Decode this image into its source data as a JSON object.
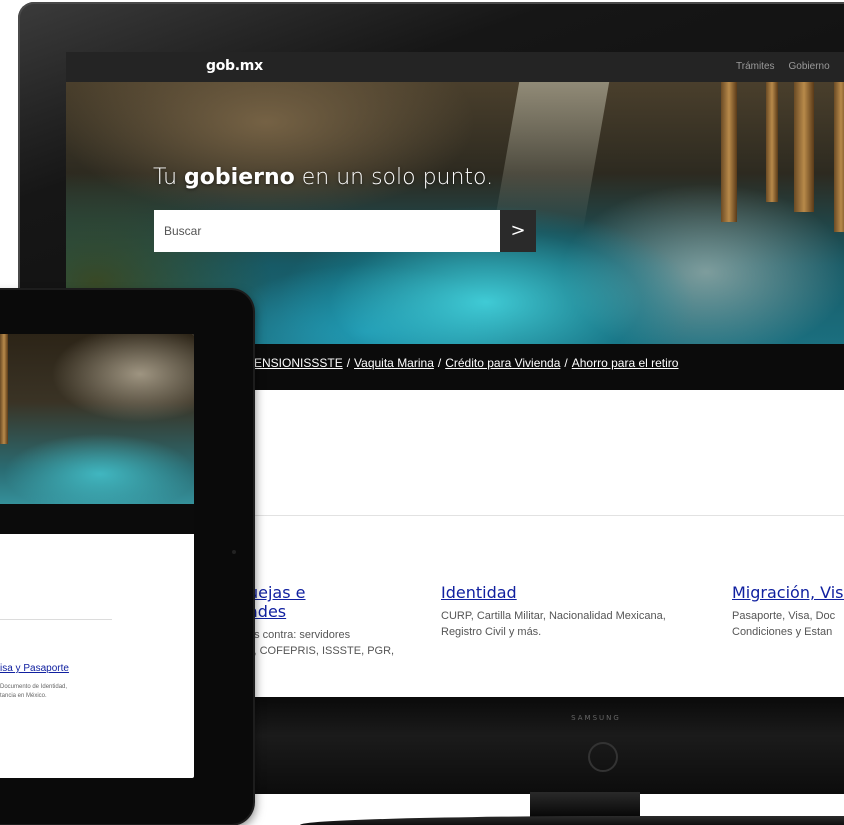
{
  "monitor": {
    "brand": "SAMSUNG",
    "site": {
      "logo": "gob.mx",
      "nav": [
        "Trámites",
        "Gobierno"
      ],
      "hero": {
        "title_before": "Tu ",
        "title_bold": "gobierno",
        "title_after": " en un solo punto.",
        "search_placeholder": "Buscar",
        "search_button": ">"
      },
      "quicklinks": {
        "items": [
          "PENSIONISSSTE",
          "Vaquita Marina",
          "Crédito para Vivienda",
          "Ahorro para el retiro"
        ],
        "separator": "/"
      },
      "categories": [
        {
          "title_line1": "uejas e",
          "title_line2": "ades",
          "desc_line1": "as contra: servidores",
          "desc_line2": "s, COFEPRIS, ISSSTE, PGR,"
        },
        {
          "title_line1": "Identidad",
          "desc_line1": "CURP, Cartilla Militar, Nacionalidad Mexicana,",
          "desc_line2": "Registro Civil y más."
        },
        {
          "title_line1": "Migración, Visa",
          "desc_line1": "Pasaporte, Visa, Doc",
          "desc_line2": "Condiciones y Estan"
        }
      ]
    }
  },
  "tablet": {
    "category_title": "isa y Pasaporte",
    "category_desc_line1": "Documento de Identidad,",
    "category_desc_line2": "tancia en México."
  },
  "colors": {
    "link": "#1020a0",
    "nav_bg": "#242424",
    "bar_bg": "#0b0b0b"
  },
  "icons": {
    "search_button": "chevron-right-icon"
  }
}
